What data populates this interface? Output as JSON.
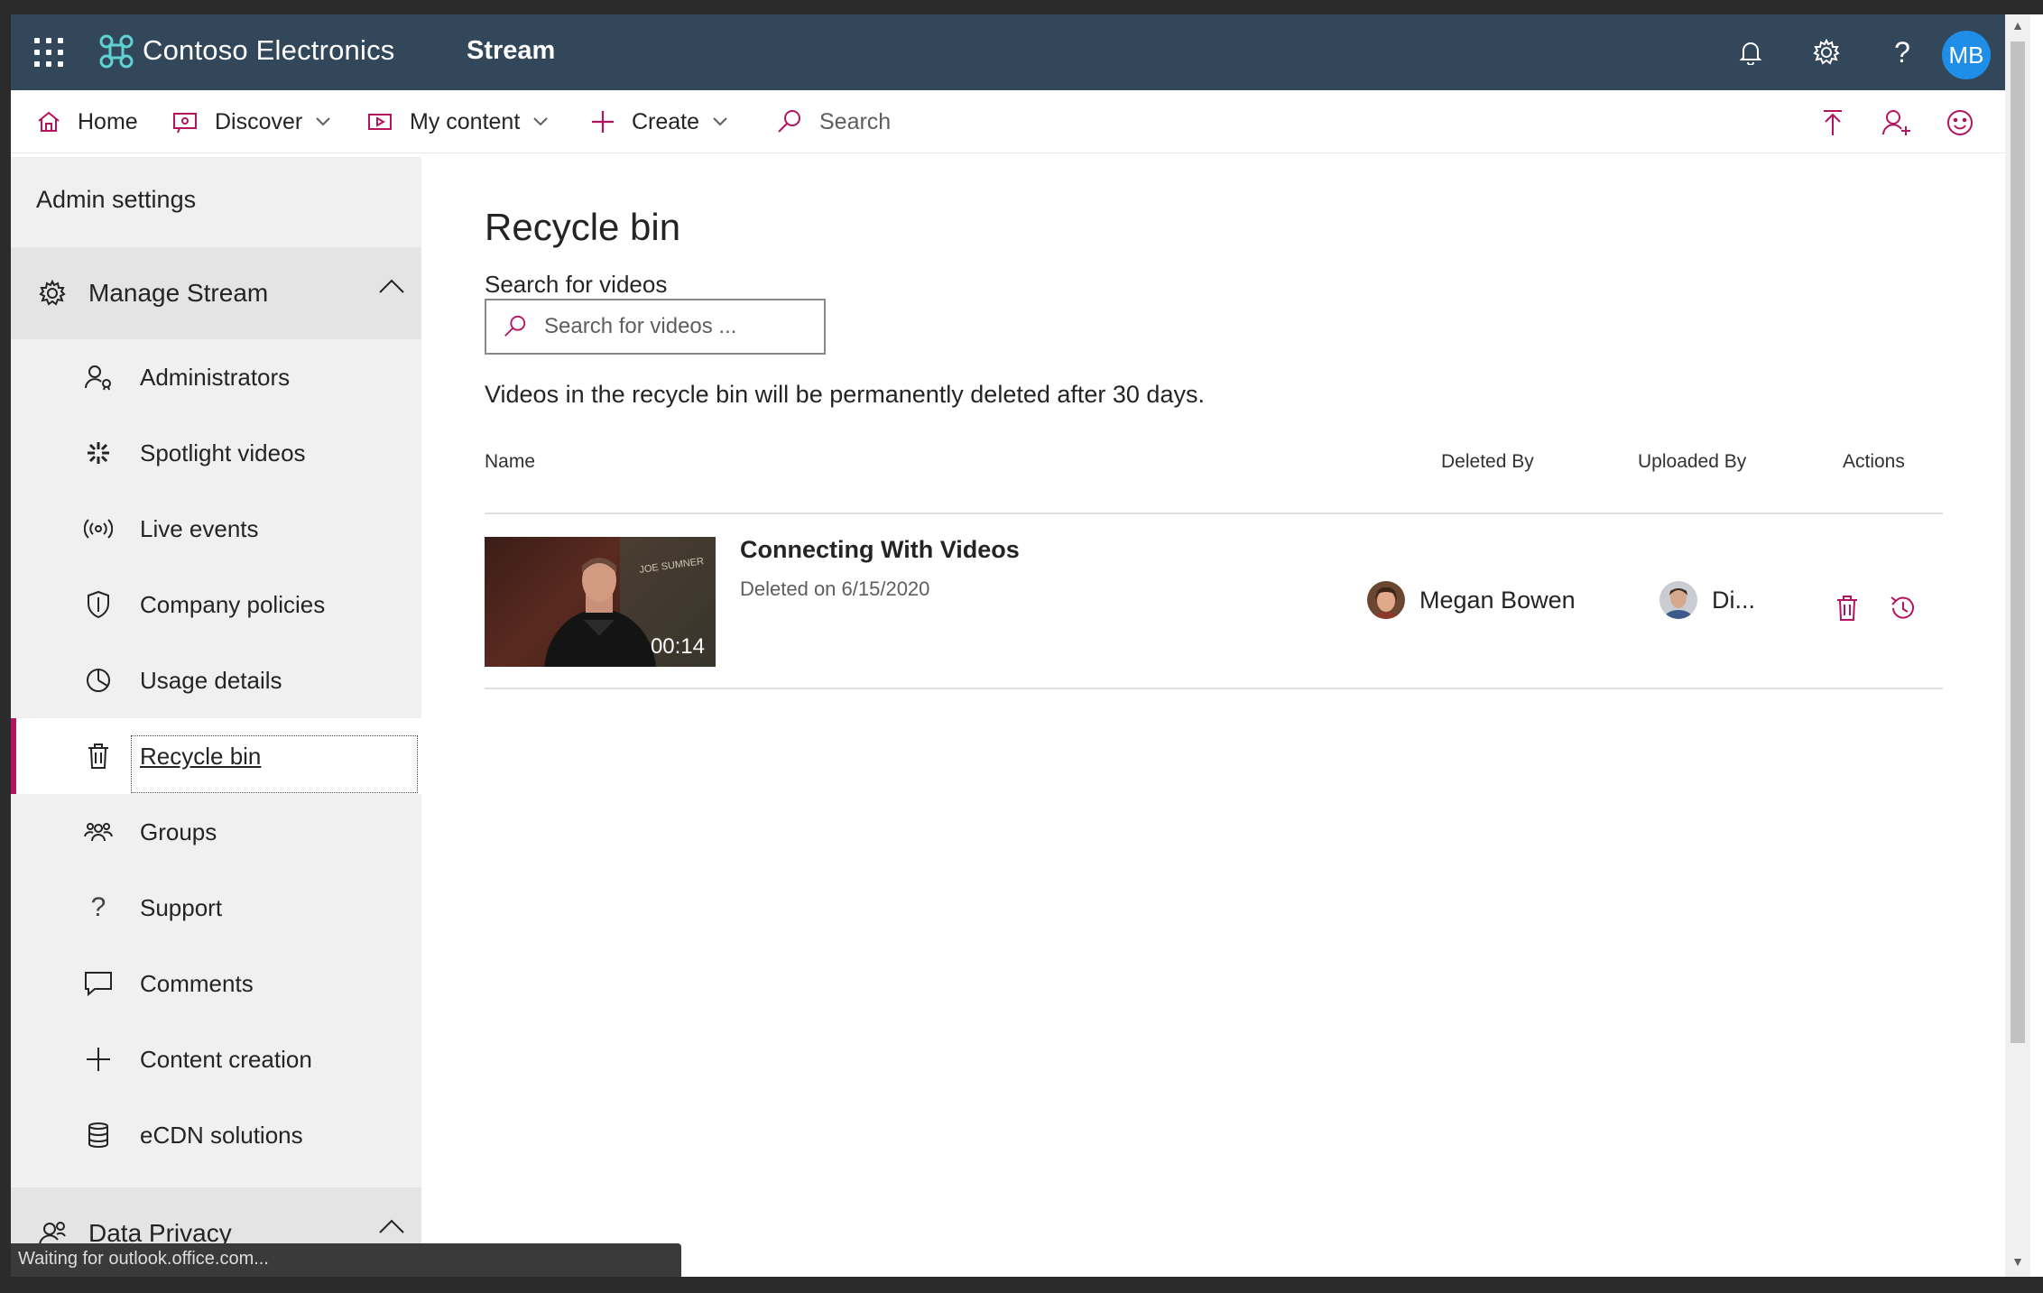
{
  "topbar": {
    "brand": "Contoso Electronics",
    "app": "Stream",
    "avatar_initials": "MB"
  },
  "nav": {
    "home": "Home",
    "discover": "Discover",
    "my_content": "My content",
    "create": "Create",
    "search_placeholder": "Search"
  },
  "sidebar": {
    "heading": "Admin settings",
    "manage_section": "Manage Stream",
    "items": [
      {
        "label": "Administrators",
        "icon": "administrators-icon"
      },
      {
        "label": "Spotlight videos",
        "icon": "spotlight-icon"
      },
      {
        "label": "Live events",
        "icon": "live-events-icon"
      },
      {
        "label": "Company policies",
        "icon": "shield-icon"
      },
      {
        "label": "Usage details",
        "icon": "pie-chart-icon"
      },
      {
        "label": "Recycle bin",
        "icon": "trash-icon"
      },
      {
        "label": "Groups",
        "icon": "groups-icon"
      },
      {
        "label": "Support",
        "icon": "question-icon"
      },
      {
        "label": "Comments",
        "icon": "comment-icon"
      },
      {
        "label": "Content creation",
        "icon": "plus-icon"
      },
      {
        "label": "eCDN solutions",
        "icon": "database-icon"
      }
    ],
    "active": "Recycle bin",
    "privacy_section": "Data Privacy"
  },
  "main": {
    "title": "Recycle bin",
    "search_label": "Search for videos",
    "search_placeholder": "Search for videos ...",
    "notice": "Videos in the recycle bin will be permanently deleted after 30 days.",
    "columns": {
      "name": "Name",
      "deleted_by": "Deleted By",
      "uploaded_by": "Uploaded By",
      "actions": "Actions"
    },
    "rows": [
      {
        "title": "Connecting With Videos",
        "deleted_on": "Deleted on 6/15/2020",
        "duration": "00:14",
        "thumb_caption": "JOE SUMNER",
        "deleted_by": "Megan Bowen",
        "uploaded_by": "Di..."
      }
    ]
  },
  "status_bar": "Waiting for outlook.office.com...",
  "colors": {
    "topbar": "#33475b",
    "accent": "#b4135e",
    "avatar": "#1f8ee8"
  }
}
